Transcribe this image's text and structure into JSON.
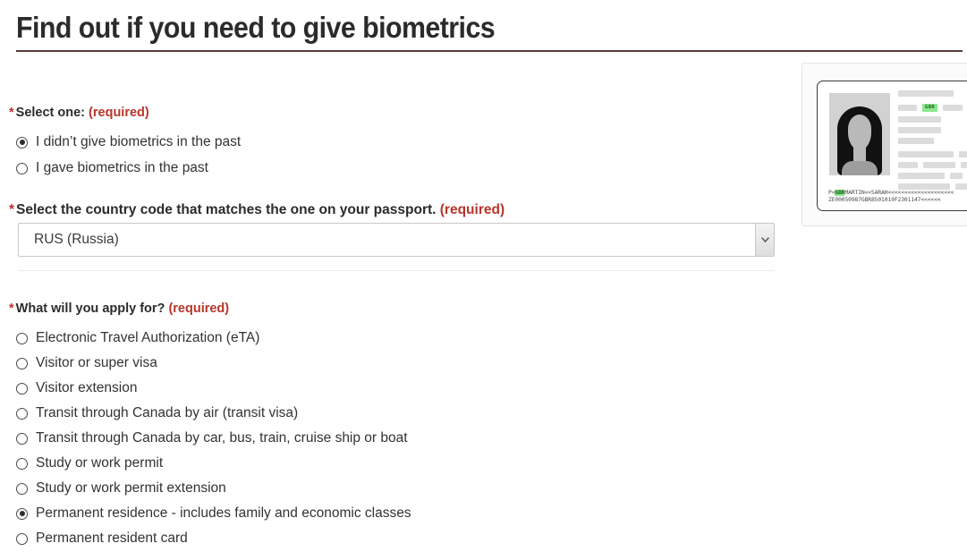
{
  "page": {
    "title": "Find out if you need to give biometrics",
    "accent_rule_color": "#5a3a3a",
    "required_color": "#b8352a"
  },
  "biometrics_question": {
    "label": "Select one:",
    "required_marker": "*",
    "required_text": "(required)",
    "options": [
      {
        "label": "I didn’t give biometrics in the past",
        "selected": true
      },
      {
        "label": "I gave biometrics in the past",
        "selected": false
      }
    ]
  },
  "country_question": {
    "label": "Select the country code that matches the one on your passport.",
    "required_marker": "*",
    "required_text": "(required)",
    "selected_value": "RUS (Russia)",
    "dropdown_icon": "chevron-down-icon"
  },
  "apply_question": {
    "label": "What will you apply for?",
    "required_marker": "*",
    "required_text": "(required)",
    "options": [
      {
        "label": "Electronic Travel Authorization (eTA)",
        "selected": false
      },
      {
        "label": "Visitor or super visa",
        "selected": false
      },
      {
        "label": "Visitor extension",
        "selected": false
      },
      {
        "label": "Transit through Canada by air (transit visa)",
        "selected": false
      },
      {
        "label": "Transit through Canada by car, bus, train, cruise ship or boat",
        "selected": false
      },
      {
        "label": "Study or work permit",
        "selected": false
      },
      {
        "label": "Study or work permit extension",
        "selected": false
      },
      {
        "label": "Permanent residence - includes family and economic classes",
        "selected": true
      },
      {
        "label": "Permanent resident card",
        "selected": false
      }
    ]
  },
  "passport_illustration": {
    "country_code_highlight": "GBR",
    "highlight_color": "#8ae88a",
    "photo_alt": "passport-photo-silhouette",
    "mrz_line_1_prefix": "P<",
    "mrz_line_1_code": "GBR",
    "mrz_line_1_suffix": "MARTIN<<SARAH<<<<<<<<<<<<<<<<<<<<",
    "mrz_line_2": "ZE00050987GBR8501019F2301147<<<<<<"
  }
}
